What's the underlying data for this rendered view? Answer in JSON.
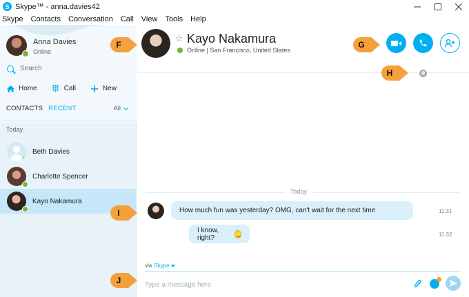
{
  "window": {
    "title": "Skype™ - anna.davies42",
    "logo": "skype-logo-icon",
    "controls": [
      "minimize-icon",
      "maximize-icon",
      "close-icon"
    ]
  },
  "menu": [
    "Skype",
    "Contacts",
    "Conversation",
    "Call",
    "View",
    "Tools",
    "Help"
  ],
  "profile": {
    "name": "Anna Davies",
    "status": "Online"
  },
  "search": {
    "placeholder": "Search"
  },
  "nav": {
    "home": "Home",
    "call": "Call",
    "new": "New"
  },
  "tabs": {
    "contacts": "CONTACTS",
    "recent": "RECENT",
    "filter": "All"
  },
  "recent": {
    "section": "Today",
    "items": [
      {
        "name": "Beth Davies",
        "status": "offline"
      },
      {
        "name": "Charlotte Spencer",
        "status": "online"
      },
      {
        "name": "Kayo Nakamura",
        "status": "online",
        "selected": true
      }
    ]
  },
  "contact": {
    "name": "Kayo Nakamura",
    "status_line": "Online | San Francisco, United States"
  },
  "conversation": {
    "day": "Today",
    "messages": [
      {
        "text": "How much fun was yesterday? OMG, can't wait for the next time",
        "time": "11:31",
        "direction": "incoming"
      },
      {
        "text": "I know, right?",
        "time": "11:32",
        "direction": "outgoing"
      }
    ]
  },
  "compose": {
    "via": "via",
    "via_service": "Skype",
    "placeholder": "Type a message here"
  },
  "callouts": {
    "f": "F",
    "g": "G",
    "h": "H",
    "i": "I",
    "j": "J"
  },
  "colors": {
    "accent": "#00aff0",
    "online": "#7bb32e",
    "callout": "#f5a03a",
    "sidebar_bg": "#e8f2f9",
    "selected_bg": "#c6e7f9",
    "bubble_bg": "#d9f0fb"
  }
}
